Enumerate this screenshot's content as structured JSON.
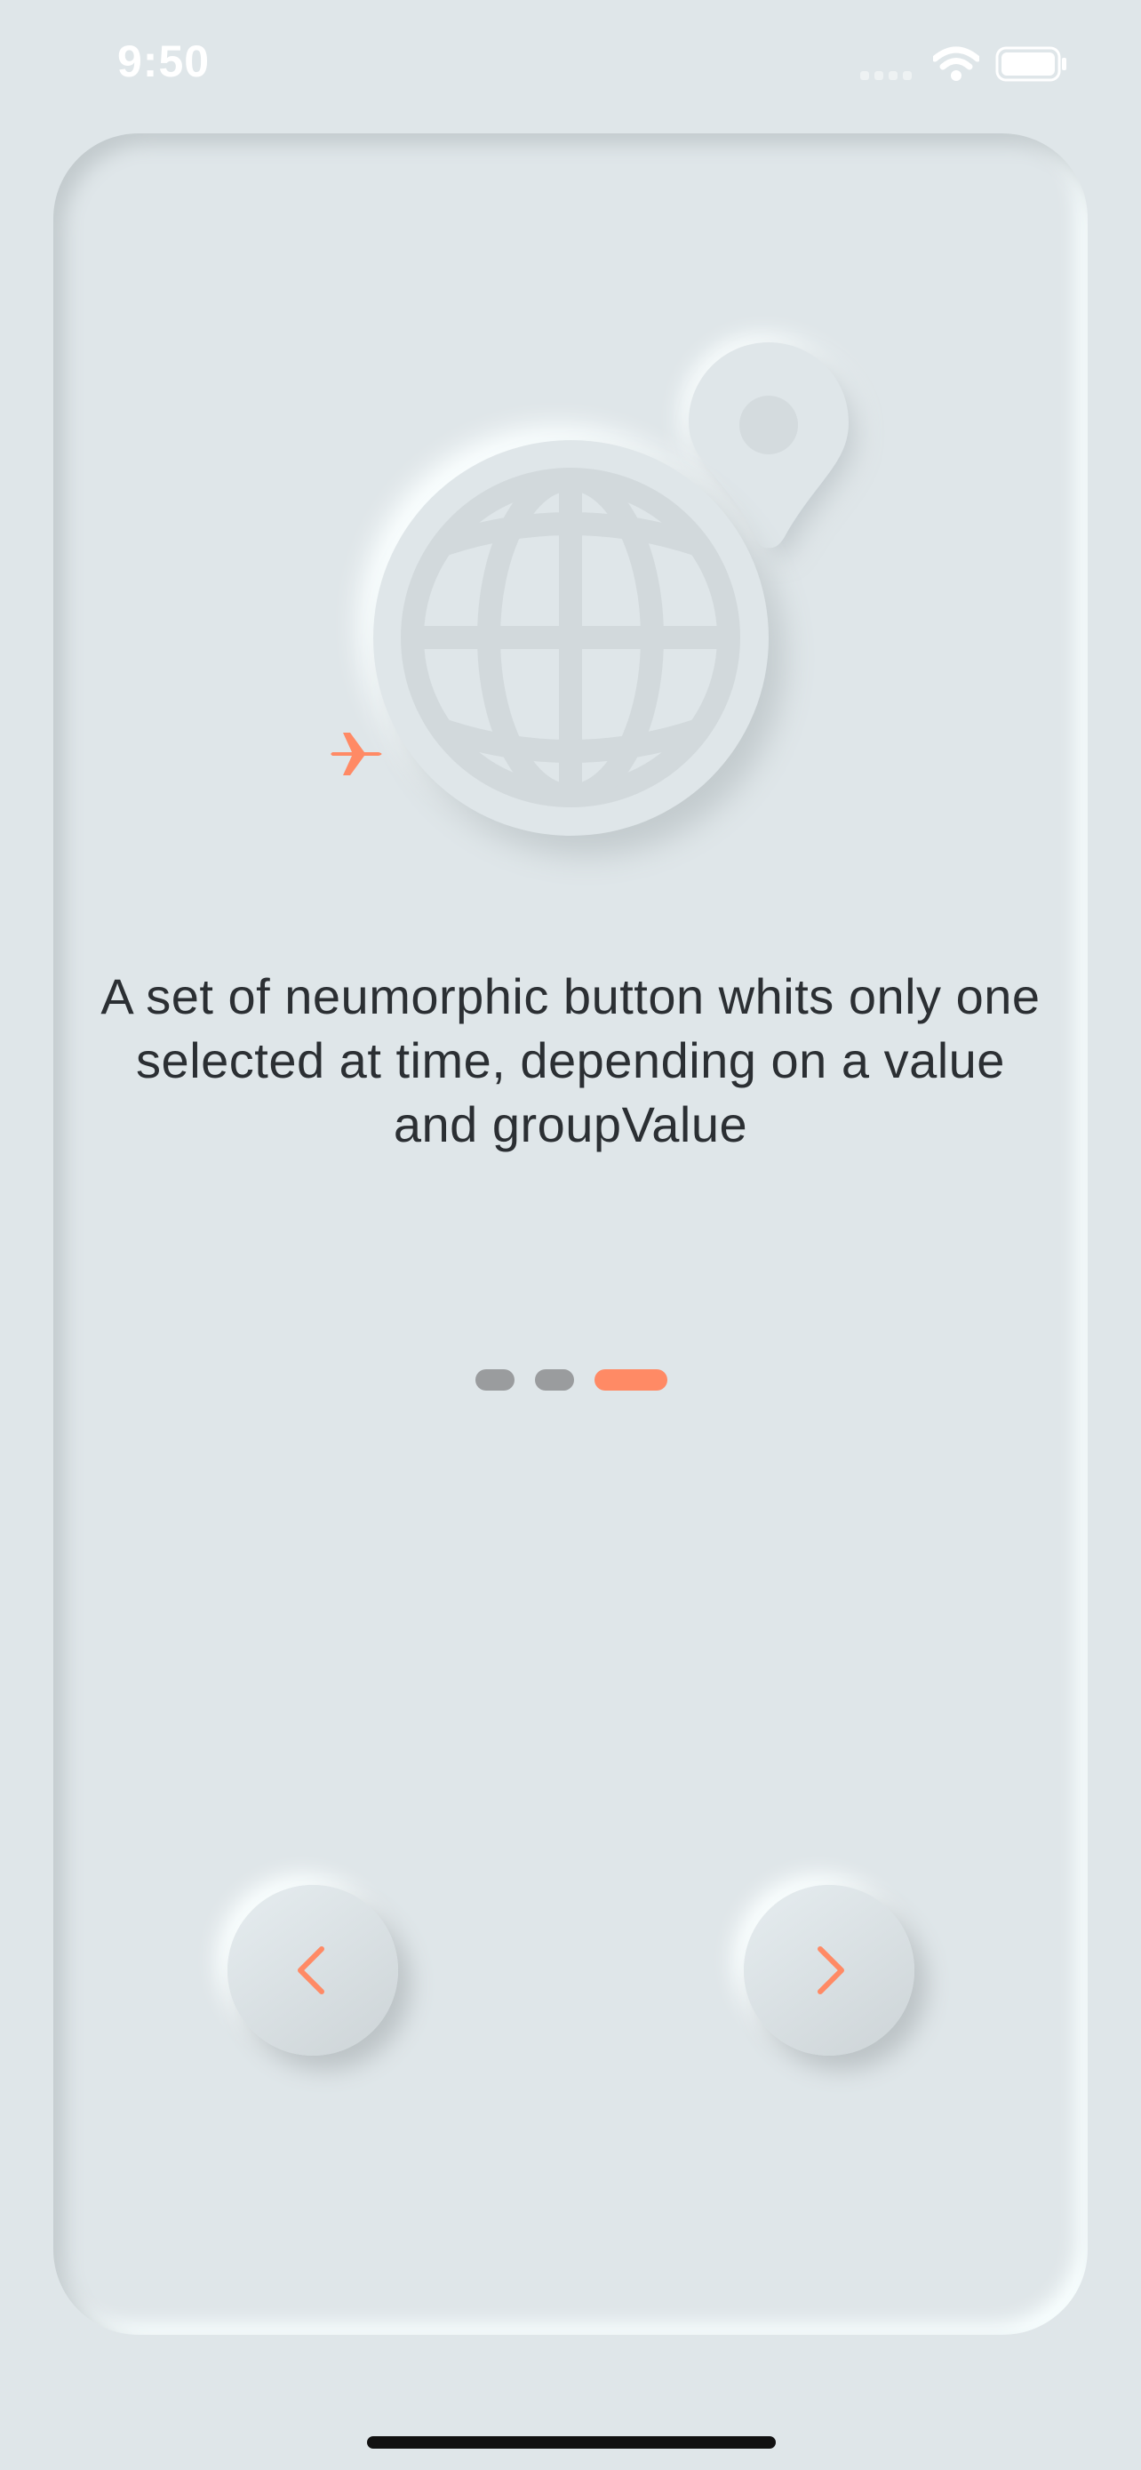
{
  "status_bar": {
    "time": "9:50",
    "signal_icon": "cellular-signal-icon",
    "wifi_icon": "wifi-icon",
    "battery_icon": "battery-icon"
  },
  "hero": {
    "globe_icon": "globe-icon",
    "pin_icon": "location-pin-icon",
    "plane_icon": "airplane-icon"
  },
  "description": "A set of neumorphic button whits only one selected at time, depending on a value and groupValue",
  "pager": {
    "count": 3,
    "active_index": 2
  },
  "navigation": {
    "prev_icon": "chevron-left-icon",
    "next_icon": "chevron-right-icon"
  },
  "colors": {
    "background": "#dfe6e9",
    "accent": "#ff8a65",
    "inactive_dot": "#9a9c9e",
    "text": "#2b2f33"
  }
}
